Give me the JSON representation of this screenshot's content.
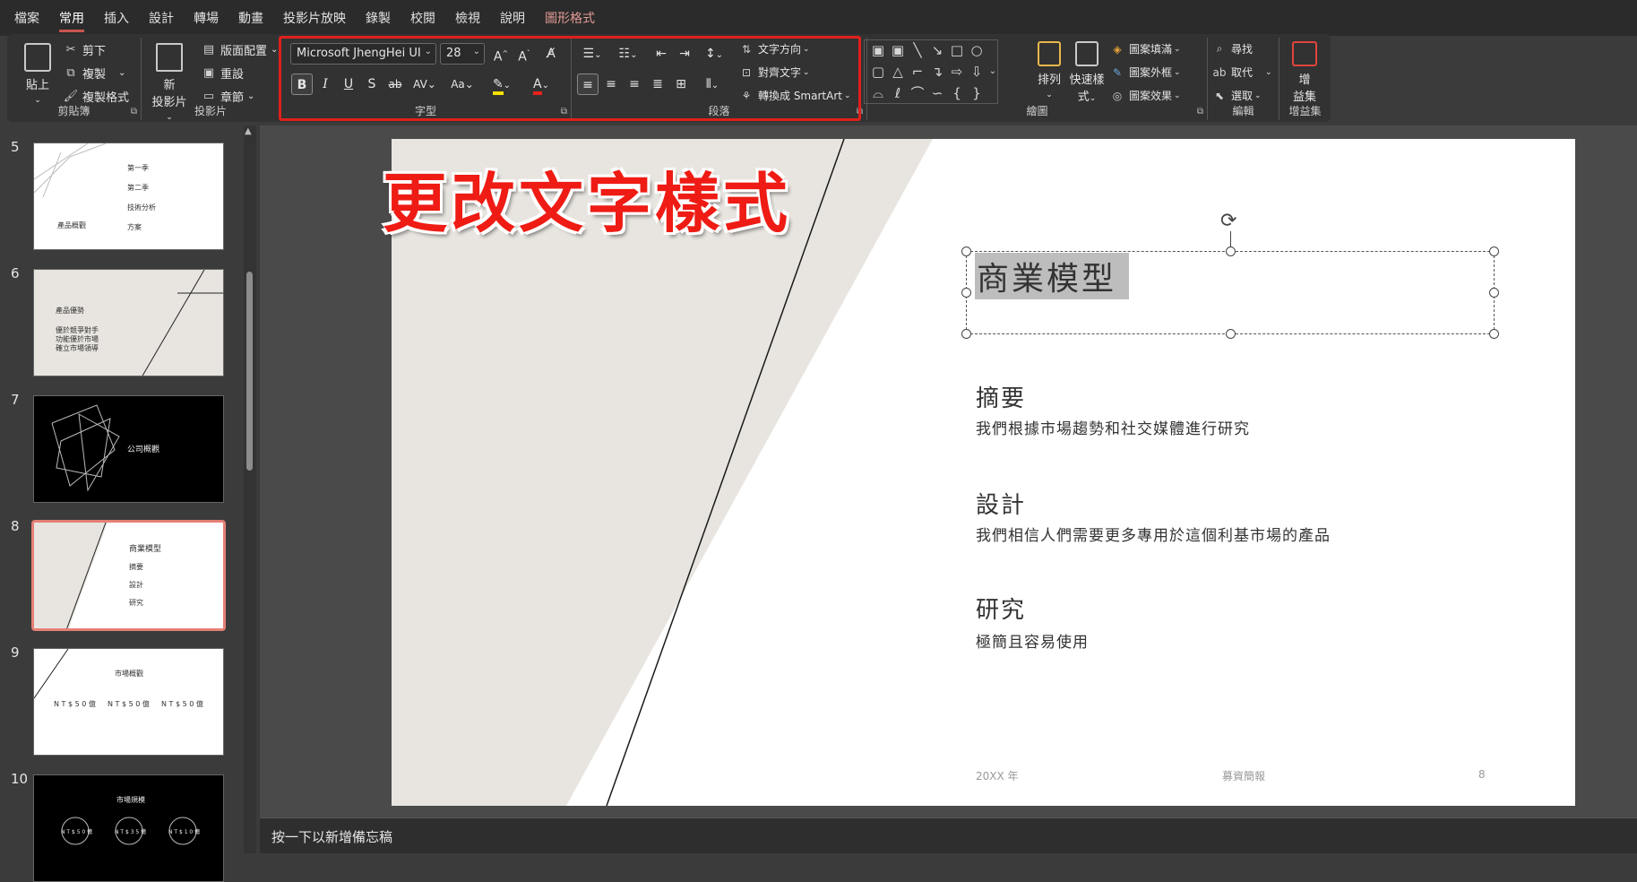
{
  "menu": {
    "items": [
      "檔案",
      "常用",
      "插入",
      "設計",
      "轉場",
      "動畫",
      "投影片放映",
      "錄製",
      "校閱",
      "檢視",
      "說明"
    ],
    "contextual_tab": "圖形格式"
  },
  "ribbon": {
    "clipboard": {
      "paste": "貼上",
      "cut": "剪下",
      "copy": "複製",
      "format_painter": "複製格式",
      "label": "剪貼簿"
    },
    "slides": {
      "new_slide_line1": "新",
      "new_slide_line2": "投影片",
      "layout": "版面配置",
      "reset": "重設",
      "section": "章節",
      "label": "投影片"
    },
    "font": {
      "font_name": "Microsoft JhengHei UI",
      "font_size": "28",
      "label": "字型"
    },
    "paragraph": {
      "text_direction": "文字方向",
      "align_text": "對齊文字",
      "convert_smartart": "轉換成 SmartArt",
      "label": "段落"
    },
    "drawing": {
      "arrange": "排列",
      "quick_styles_line1": "快速樣",
      "quick_styles_line2": "式",
      "shape_fill": "圖案填滿",
      "shape_outline": "圖案外框",
      "shape_effects": "圖案效果",
      "label": "繪圖"
    },
    "editing": {
      "find": "尋找",
      "replace": "取代",
      "select": "選取",
      "label": "編輯"
    },
    "addins": {
      "addins_line1": "增",
      "addins_line2": "益集",
      "label": "增益集"
    }
  },
  "thumbnails": [
    {
      "num": "5",
      "title": "產品概觀",
      "lines": [
        "第一季",
        "第二季",
        "技術分析",
        "方案"
      ],
      "dark": false
    },
    {
      "num": "6",
      "title": "產品優勢",
      "lines": [
        "優於競爭對手",
        "功能優於市場",
        "確立市場領導"
      ],
      "dark": false
    },
    {
      "num": "7",
      "title": "公司概觀",
      "lines": [],
      "dark": true
    },
    {
      "num": "8",
      "title": "商業模型",
      "lines": [
        "摘要",
        "設計",
        "研究"
      ],
      "dark": false
    },
    {
      "num": "9",
      "title": "市場概觀",
      "lines": [
        "N T $ 5 0 億",
        "N T $ 5 0 億",
        "N T $ 5 0 億"
      ],
      "dark": false
    },
    {
      "num": "10",
      "title": "市場規模",
      "lines": [
        "N T $ 5 0 億",
        "N T $ 3 5 億",
        "N T $ 1 0 億"
      ],
      "dark": true
    }
  ],
  "annotation": "更改文字樣式",
  "slide": {
    "title": "商業模型",
    "sections": [
      {
        "heading": "摘要",
        "body": "我們根據市場趨勢和社交媒體進行研究"
      },
      {
        "heading": "設計",
        "body": "我們相信人們需要更多專用於這個利基市場的產品"
      },
      {
        "heading": "研究",
        "body": "極簡且容易使用"
      }
    ],
    "footer_left": "20XX 年",
    "footer_center": "募資簡報",
    "footer_right": "8"
  },
  "notes_placeholder": "按一下以新增備忘稿",
  "colors": {
    "accent": "#c8554e",
    "annotation_red": "#ee1c14",
    "slide_bg": "#ffffff",
    "slide_shape": "#e8e5e0"
  }
}
